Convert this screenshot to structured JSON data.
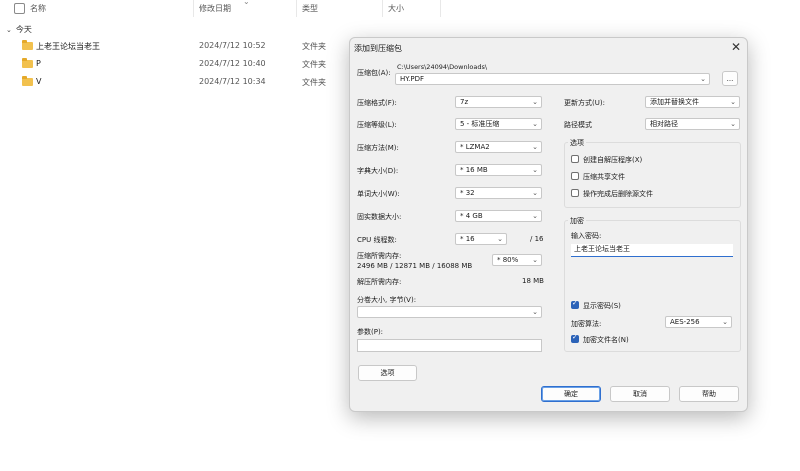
{
  "explorer": {
    "columns": {
      "name": "名称",
      "date": "修改日期",
      "type": "类型",
      "size": "大小"
    },
    "group_label": "今天",
    "rows": [
      {
        "name": "上老王论坛当老王",
        "date": "2024/7/12 10:52",
        "type": "文件夹"
      },
      {
        "name": "P",
        "date": "2024/7/12 10:40",
        "type": "文件夹"
      },
      {
        "name": "V",
        "date": "2024/7/12 10:34",
        "type": "文件夹"
      }
    ]
  },
  "dialog": {
    "title": "添加到压缩包",
    "close_glyph": "✕",
    "archive": {
      "label": "压缩包(A):",
      "path": "C:\\Users\\24094\\Downloads\\",
      "value": "HY.PDF",
      "browse_label": "..."
    },
    "left": {
      "format_label": "压缩格式(F):",
      "format_value": "7z",
      "level_label": "压缩等级(L):",
      "level_value": "5 - 标准压缩",
      "method_label": "压缩方法(M):",
      "method_value": "* LZMA2",
      "dict_label": "字典大小(D):",
      "dict_value": "* 16 MB",
      "word_label": "单词大小(W):",
      "word_value": "* 32",
      "solid_label": "固实数据大小:",
      "solid_value": "* 4 GB",
      "cpu_label": "CPU 线程数:",
      "cpu_value": "* 16",
      "cpu_total": "/ 16",
      "mem_label": "压缩所需内存:",
      "mem_detail": "2496 MB / 12871 MB / 16088 MB",
      "mem_percent": "* 80%",
      "decomp_label": "解压所需内存:",
      "decomp_value": "18 MB",
      "split_label": "分卷大小, 字节(V):",
      "split_value": "",
      "params_label": "参数(P):",
      "params_value": "",
      "options_button": "选项"
    },
    "right": {
      "update_label": "更新方式(U):",
      "update_value": "添加并替换文件",
      "path_label": "路径模式",
      "path_value": "相对路径",
      "options_group": "选项",
      "opt_sfx": "创建自解压程序(X)",
      "opt_shared": "压缩共享文件",
      "opt_delete": "操作完成后删除源文件",
      "encrypt_group": "加密",
      "password_label": "输入密码:",
      "password_value": "上老王论坛当老王",
      "show_password": "显示密码(S)",
      "enc_method_label": "加密算法:",
      "enc_method_value": "AES-256",
      "enc_filenames": "加密文件名(N)"
    },
    "buttons": {
      "ok": "确定",
      "cancel": "取消",
      "help": "帮助"
    }
  },
  "icons": {
    "chevron": "chevron-down-icon",
    "folder": "folder-icon",
    "close": "close-icon"
  }
}
